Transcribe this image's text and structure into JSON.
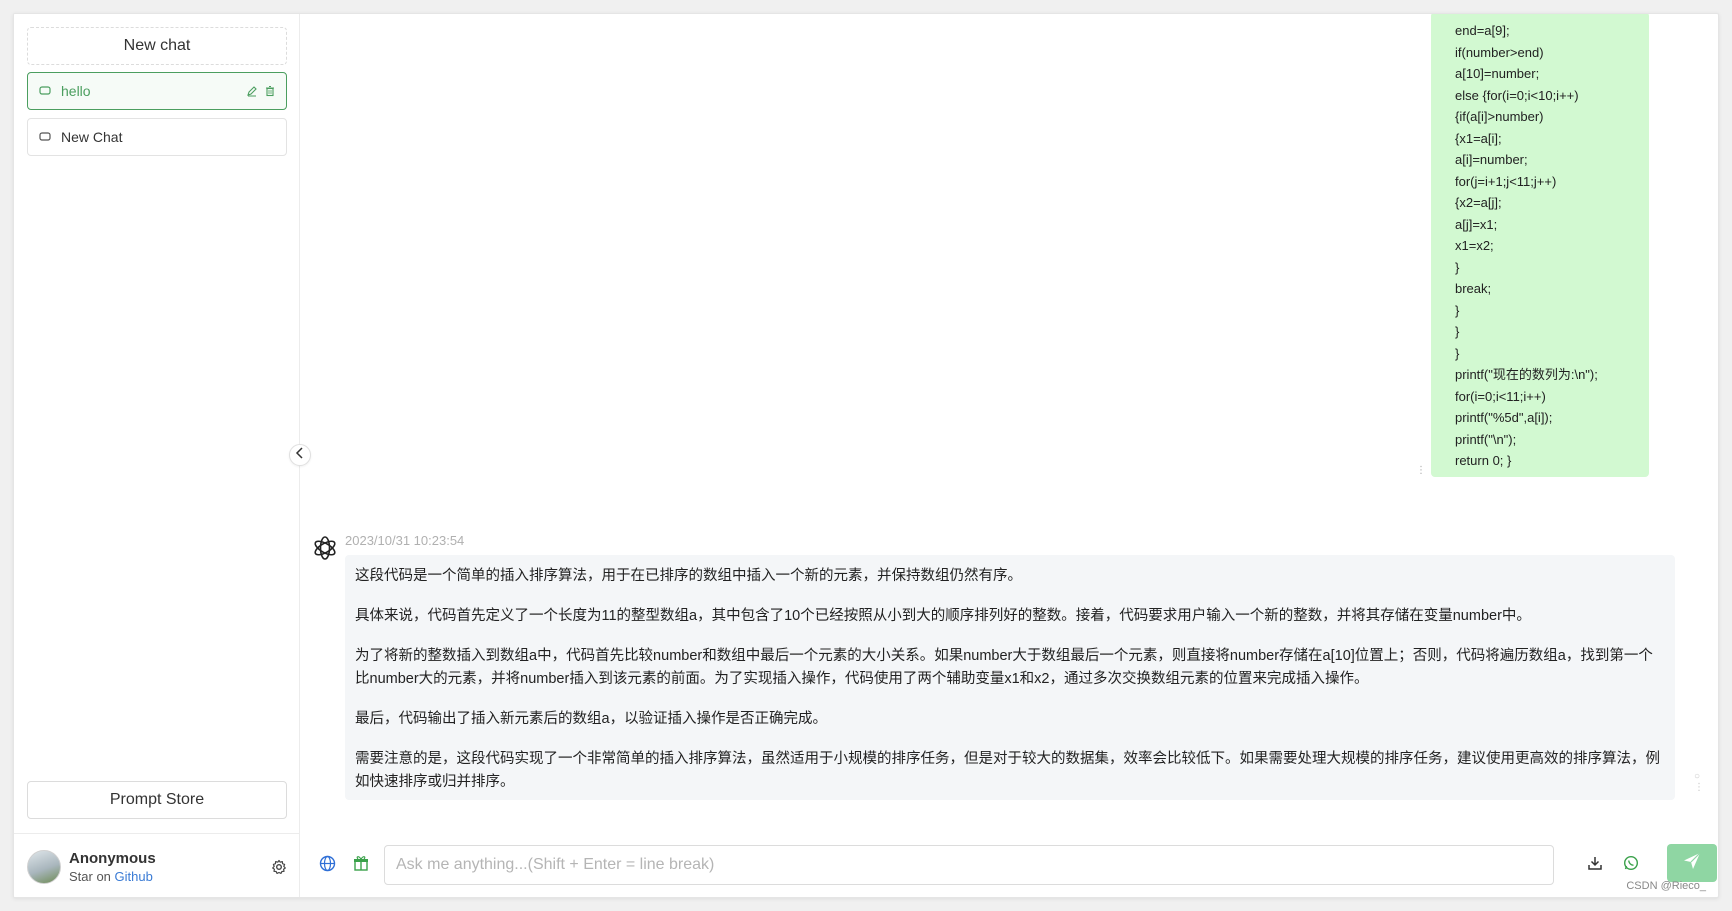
{
  "sidebar": {
    "new_chat_label": "New chat",
    "conversations": [
      {
        "label": "hello",
        "active": true
      },
      {
        "label": "New Chat",
        "active": false
      }
    ],
    "prompt_store_label": "Prompt Store",
    "user": {
      "name": "Anonymous",
      "star_prefix": "Star on",
      "github_link": "Github"
    }
  },
  "messages": {
    "user_code": "end=a[9];\nif(number>end)\na[10]=number;\nelse {for(i=0;i<10;i++)\n{if(a[i]>number)\n{x1=a[i];\na[i]=number;\nfor(j=i+1;j<11;j++)\n{x2=a[j];\na[j]=x1;\nx1=x2;\n}\nbreak;\n}\n}\n}\nprintf(\"现在的数列为:\\n\");\nfor(i=0;i<11;i++)\nprintf(\"%5d\",a[i]);\nprintf(\"\\n\");\nreturn 0; }",
    "bot_timestamp": "2023/10/31 10:23:54",
    "bot_paragraphs": [
      "这段代码是一个简单的插入排序算法，用于在已排序的数组中插入一个新的元素，并保持数组仍然有序。",
      "具体来说，代码首先定义了一个长度为11的整型数组a，其中包含了10个已经按照从小到大的顺序排列好的整数。接着，代码要求用户输入一个新的整数，并将其存储在变量number中。",
      "为了将新的整数插入到数组a中，代码首先比较number和数组中最后一个元素的大小关系。如果number大于数组最后一个元素，则直接将number存储在a[10]位置上；否则，代码将遍历数组a，找到第一个比number大的元素，并将number插入到该元素的前面。为了实现插入操作，代码使用了两个辅助变量x1和x2，通过多次交换数组元素的位置来完成插入操作。",
      "最后，代码输出了插入新元素后的数组a，以验证插入操作是否正确完成。",
      "需要注意的是，这段代码实现了一个非常简单的插入排序算法，虽然适用于小规模的排序任务，但是对于较大的数据集，效率会比较低下。如果需要处理大规模的排序任务，建议使用更高效的排序算法，例如快速排序或归并排序。"
    ]
  },
  "input": {
    "placeholder": "Ask me anything...(Shift + Enter = line break)",
    "value": ""
  },
  "watermark": "CSDN @Rieco_",
  "colors": {
    "accent": "#4b9e5f",
    "user_bubble": "#d2f9d1",
    "bot_bubble": "#f4f6f8",
    "send_button": "#8fd6a3"
  }
}
